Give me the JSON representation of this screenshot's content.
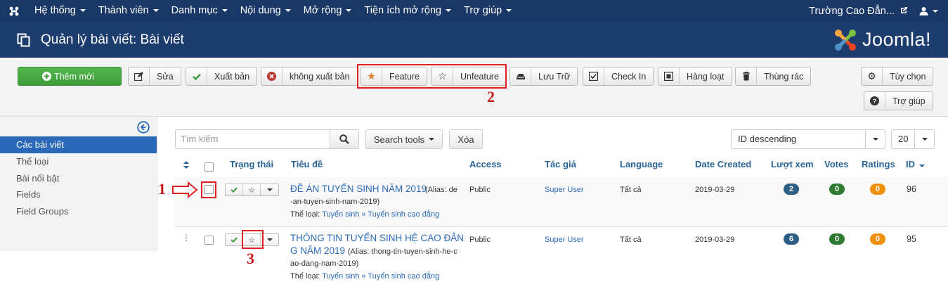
{
  "topnav": {
    "menu": [
      {
        "label": "Hệ thống"
      },
      {
        "label": "Thành viên"
      },
      {
        "label": "Danh mục"
      },
      {
        "label": "Nội dung"
      },
      {
        "label": "Mở rộng"
      },
      {
        "label": "Tiện ích mở rộng"
      },
      {
        "label": "Trợ giúp"
      }
    ],
    "site_name": "Trường Cao Đẳn...",
    "icons": {
      "logo": "joomla-logo-icon",
      "external": "external-link-icon",
      "user": "user-icon"
    }
  },
  "header": {
    "title": "Quản lý bài viết: Bài viết",
    "brand": "Joomla!",
    "colors": {
      "bar": "#1c3d6e",
      "nav": "#1a3867"
    }
  },
  "toolbar": {
    "new": "Thêm mới",
    "edit": "Sửa",
    "publish": "Xuất bản",
    "unpublish": "không xuất bản",
    "feature": "Feature",
    "unfeature": "Unfeature",
    "archive": "Lưu Trữ",
    "checkin": "Check In",
    "batch": "Hàng loạt",
    "trash": "Thùng rác",
    "options": "Tùy chọn",
    "help": "Trợ giúp"
  },
  "annotations": {
    "a1": "1",
    "a2": "2",
    "a3": "3"
  },
  "sidebar": {
    "items": [
      {
        "label": "Các bài viết",
        "active": true
      },
      {
        "label": "Thể loại"
      },
      {
        "label": "Bài nổi bật"
      },
      {
        "label": "Fields"
      },
      {
        "label": "Field Groups"
      }
    ]
  },
  "filters": {
    "search_placeholder": "Tìm kiếm",
    "search_tools": "Search tools",
    "clear": "Xóa",
    "ordering": "ID descending",
    "limit": "20"
  },
  "table": {
    "headers": {
      "status": "Trạng thái",
      "title": "Tiêu đề",
      "access": "Access",
      "author": "Tác giả",
      "language": "Language",
      "date": "Date Created",
      "hits": "Lượt xem",
      "votes": "Votes",
      "ratings": "Ratings",
      "id": "ID"
    },
    "rows": [
      {
        "title_l1": "ĐỀ ÁN TUYỂN SINH NĂM 2019",
        "alias_l1": "(Alias: de",
        "alias_l2": "-an-tuyen-sinh-nam-2019)",
        "category_label": "Thể loại:",
        "category": "Tuyển sinh » Tuyển sinh cao đẳng",
        "access": "Public",
        "author": "Super User",
        "language": "Tất cả",
        "date": "2019-03-29",
        "hits": "2",
        "votes": "0",
        "ratings": "0",
        "id": "96"
      },
      {
        "title_l1": "THÔNG TIN TUYỂN SINH HỆ CAO ĐẲN",
        "title_l2": "G NĂM 2019",
        "alias_l1": "(Alias: thong-tin-tuyen-sinh-he-c",
        "alias_l2": "ao-dang-nam-2019)",
        "category_label": "Thể loại:",
        "category": "Tuyển sinh » Tuyển sinh cao đẳng",
        "access": "Public",
        "author": "Super User",
        "language": "Tất cả",
        "date": "2019-03-29",
        "hits": "6",
        "votes": "0",
        "ratings": "0",
        "id": "95"
      }
    ]
  },
  "colors": {
    "hits_badge": "#2c5d85",
    "votes_badge": "#2f7a32",
    "ratings_badge": "#f0900a",
    "annotation": "#e02020"
  }
}
